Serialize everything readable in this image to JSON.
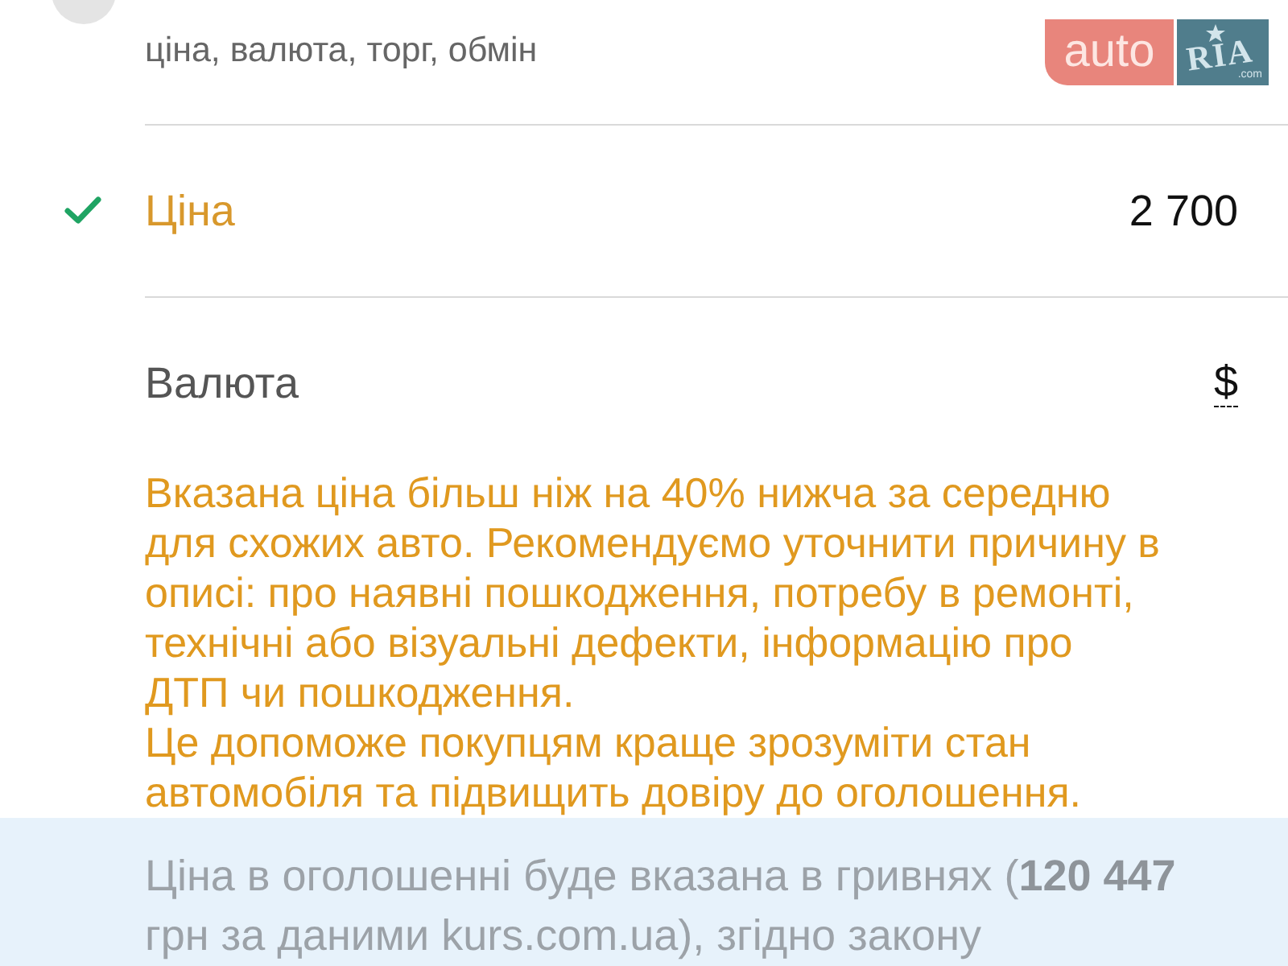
{
  "section": {
    "subtitle": "ціна, валюта, торг, обмін"
  },
  "logo": {
    "left": "auto",
    "right": "RIA",
    "domain": ".com"
  },
  "fields": [
    {
      "kind": "input",
      "label": "Ціна",
      "value": "2 700",
      "checked": true,
      "warning": true
    },
    {
      "kind": "select",
      "label": "Валюта",
      "value": "$",
      "checked": false,
      "warning": false
    }
  ],
  "warning": [
    "Вказана ціна більш ніж на 40% нижча за середню для схожих авто. Рекомендуємо уточнити причину в описі: про наявні пошкодження, потребу в ремонті, технічні або візуальні дефекти, інформацію про ДТП чи пошкодження.",
    "Це допоможе покупцям краще зрозуміти стан автомобіля та підвищить довіру до оголошення."
  ],
  "notice": "Ціна в оголошенні буде вказана в гривнях (**120 447** грн за даними kurs.com.ua), згідно закону"
}
